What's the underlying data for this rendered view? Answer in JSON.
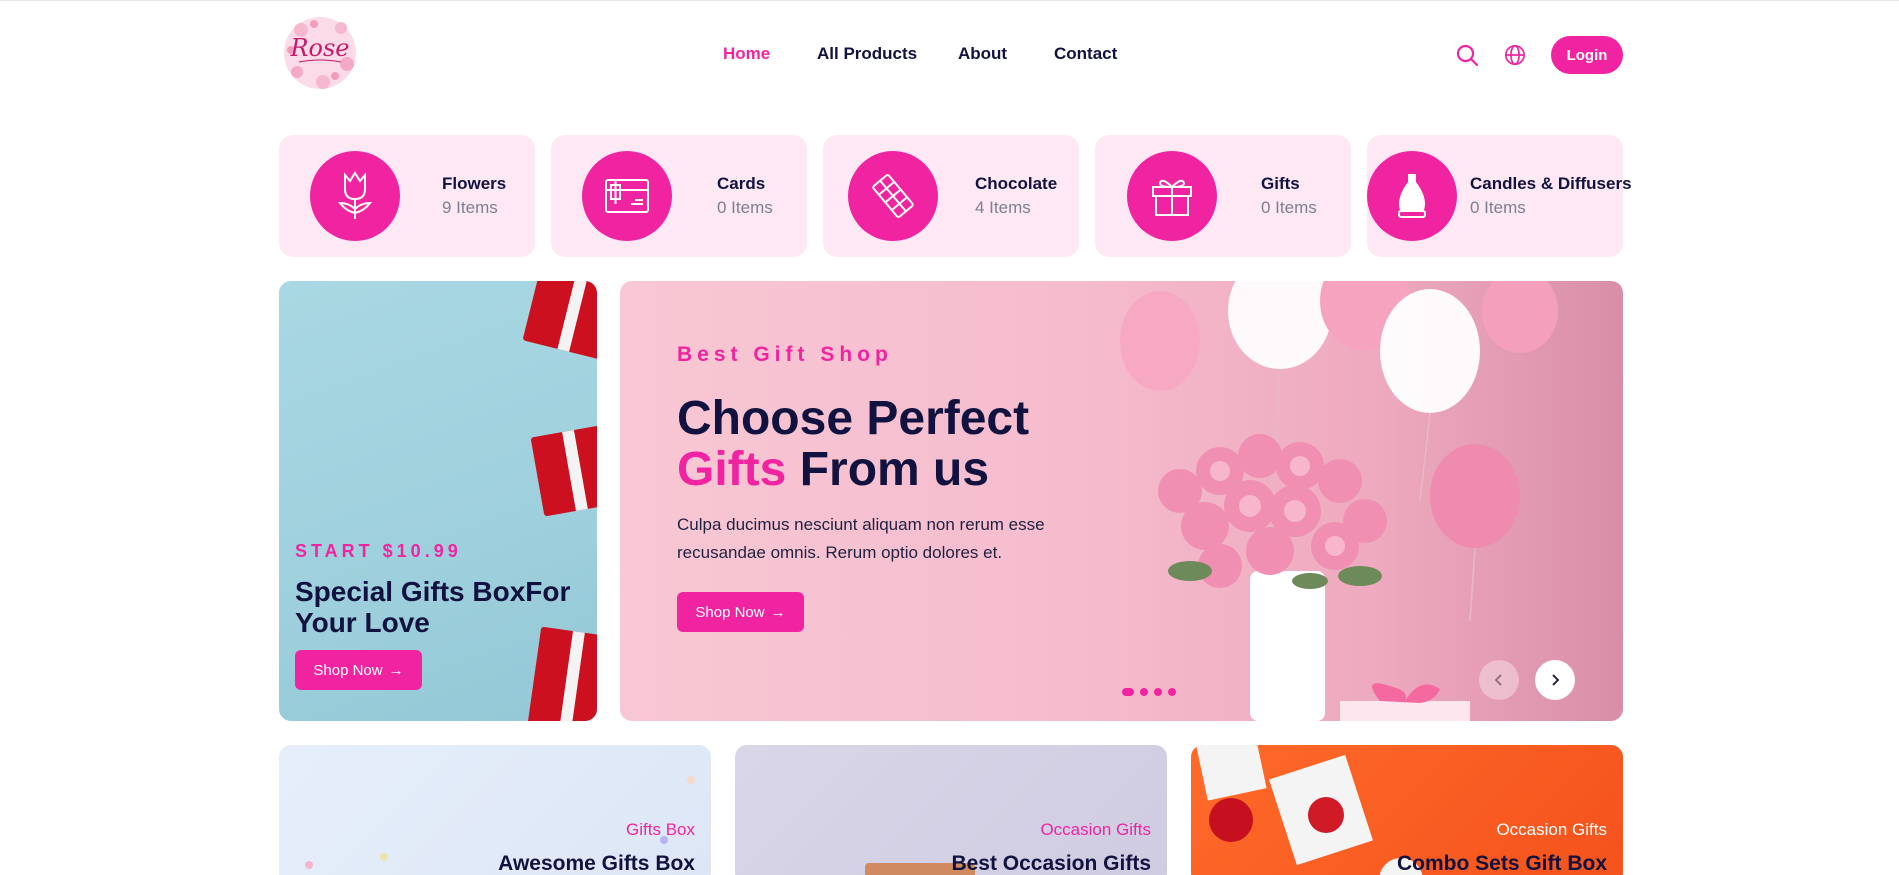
{
  "header": {
    "logo_text": "Rose",
    "nav": [
      "Home",
      "All Products",
      "About",
      "Contact"
    ],
    "active_nav": "Home",
    "login_label": "Login",
    "icons": [
      "search-icon",
      "globe-icon"
    ]
  },
  "categories": [
    {
      "name": "Flowers",
      "count": "9 Items",
      "icon": "tulip-icon"
    },
    {
      "name": "Cards",
      "count": "0 Items",
      "icon": "card-icon"
    },
    {
      "name": "Chocolate",
      "count": "4 Items",
      "icon": "chocolate-icon"
    },
    {
      "name": "Gifts",
      "count": "0 Items",
      "icon": "gift-icon"
    },
    {
      "name": "Candles & Diffusers",
      "count": "0 Items",
      "icon": "diffuser-icon"
    }
  ],
  "promo_left": {
    "tag": "START $10.99",
    "title": "Special Gifts BoxFor Your Love",
    "button": "Shop Now"
  },
  "hero": {
    "eyebrow": "Best Gift Shop",
    "title_line1": "Choose Perfect",
    "title_pink": "Gifts",
    "title_rest": "From us",
    "description": "Culpa ducimus nesciunt aliquam non rerum esse recusandae omnis. Rerum optio dolores et.",
    "button": "Shop Now",
    "slide_count": 4,
    "active_slide": 1
  },
  "bottom_cards": [
    {
      "label": "Gifts Box",
      "title": "Awesome Gifts Box"
    },
    {
      "label": "Occasion Gifts",
      "title": "Best Occasion Gifts"
    },
    {
      "label": "Occasion Gifts",
      "title": "Combo Sets Gift Box"
    }
  ],
  "colors": {
    "accent": "#f024a1",
    "text": "#11123f",
    "category_bg": "#fde8f3"
  }
}
